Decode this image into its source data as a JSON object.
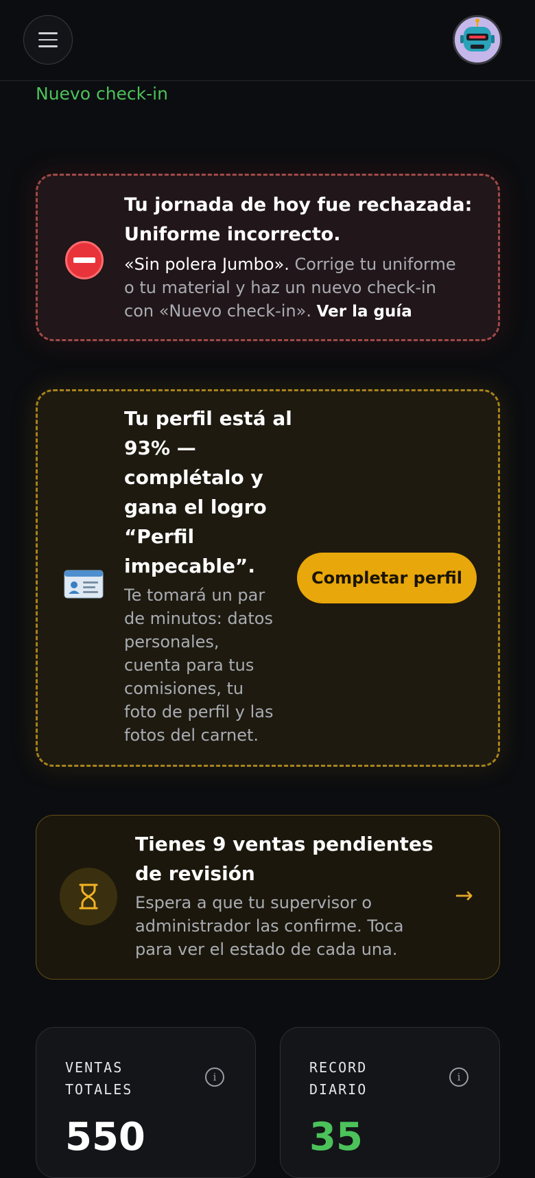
{
  "header": {
    "new_checkin_label": "Nuevo check-in"
  },
  "alerts": {
    "rejected": {
      "icon": "no-entry-icon",
      "title_line1": "Tu jornada de hoy fue rechazada:",
      "title_line2": "Uniforme incorrecto.",
      "body_highlight": "«Sin polera Jumbo».",
      "body_text1": " Corrige tu uniforme",
      "body_line2": "o tu material y haz un nuevo check-in",
      "body_line3": "con «Nuevo check-in».",
      "link_label": "Ver la guía",
      "accent_color": "#a04a48"
    },
    "profile": {
      "icon": "id-card-icon",
      "title_lines": [
        "Tu perfil está al",
        "93% —",
        "complétalo y",
        "gana el logro",
        "“Perfil",
        "impecable”."
      ],
      "body_lines": [
        "Te tomará un par",
        "de minutos: datos",
        "personales,",
        "cuenta para tus",
        "comisiones, tu",
        "foto de perfil y las",
        "fotos del carnet."
      ],
      "button_label": "Completar perfil",
      "completion_percent": 93,
      "accent_color": "#e8a70a"
    },
    "pending": {
      "icon": "hourglass-icon",
      "title_line1": "Tienes 9 ventas pendientes",
      "title_line2": "de revisión",
      "body_lines": [
        "Espera a que tu supervisor o",
        "administrador las confirme. Toca",
        "para ver el estado de cada una."
      ],
      "arrow_icon": "arrow-right-icon"
    }
  },
  "stats": [
    {
      "label_line1": "VENTAS",
      "label_line2": "TOTALES",
      "value": "550",
      "value_color": "#ffffff"
    },
    {
      "label_line1": "RECORD",
      "label_line2": "DIARIO",
      "value": "35",
      "value_color": "#4cc25a"
    }
  ]
}
